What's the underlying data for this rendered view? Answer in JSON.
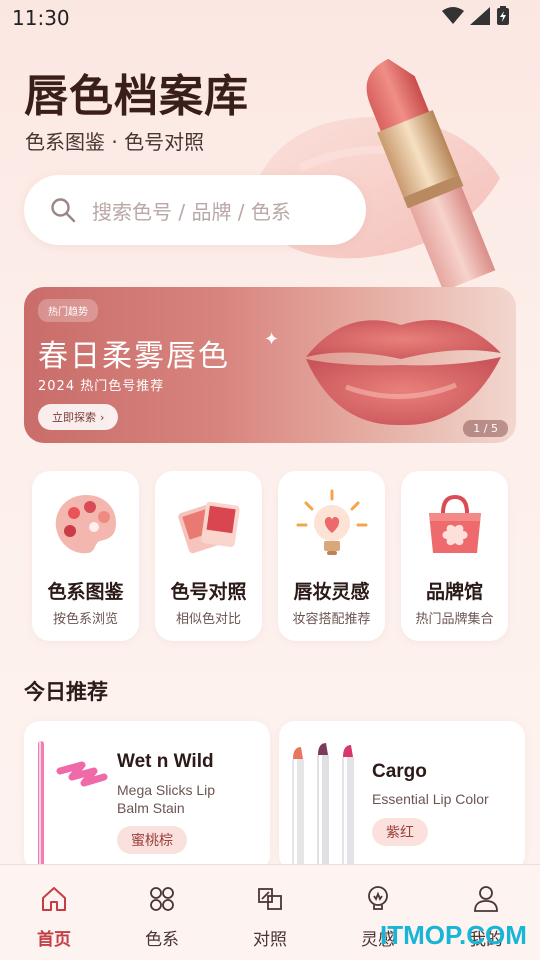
{
  "status_bar": {
    "time": "11:30"
  },
  "header": {
    "title": "唇色档案库",
    "subtitle": "色系图鉴 · 色号对照"
  },
  "search": {
    "placeholder": "搜索色号 / 品牌 / 色系"
  },
  "banner": {
    "tag": "热门趋势",
    "title": "春日柔雾唇色",
    "subtitle": "2024 热门色号推荐",
    "button_label": "立即探索",
    "pager": "1 / 5"
  },
  "categories": [
    {
      "label": "色系图鉴",
      "desc": "按色系浏览",
      "icon": "palette-icon"
    },
    {
      "label": "色号对照",
      "desc": "相似色对比",
      "icon": "swatch-cards-icon"
    },
    {
      "label": "唇妆灵感",
      "desc": "妆容搭配推荐",
      "icon": "lightbulb-icon"
    },
    {
      "label": "品牌馆",
      "desc": "热门品牌集合",
      "icon": "shopping-bag-icon"
    }
  ],
  "recommend": {
    "title": "今日推荐",
    "products": [
      {
        "brand": "Wet n Wild",
        "name": "Mega Slicks Lip Balm Stain",
        "shade": "蜜桃棕"
      },
      {
        "brand": "Cargo",
        "name": "Essential Lip Color",
        "shade": "紫红"
      }
    ]
  },
  "nav": {
    "items": [
      {
        "label": "首页",
        "icon": "home-icon",
        "active": true
      },
      {
        "label": "色系",
        "icon": "color-grid-icon",
        "active": false
      },
      {
        "label": "对照",
        "icon": "compare-icon",
        "active": false
      },
      {
        "label": "灵感",
        "icon": "idea-icon",
        "active": false
      },
      {
        "label": "我的",
        "icon": "profile-icon",
        "active": false
      }
    ]
  },
  "watermark": "ITMOP.COM",
  "colors": {
    "accent": "#c43e45",
    "background": "#fdf0ec",
    "banner": "#d8847e",
    "tag_bg": "#fbe1dd"
  }
}
